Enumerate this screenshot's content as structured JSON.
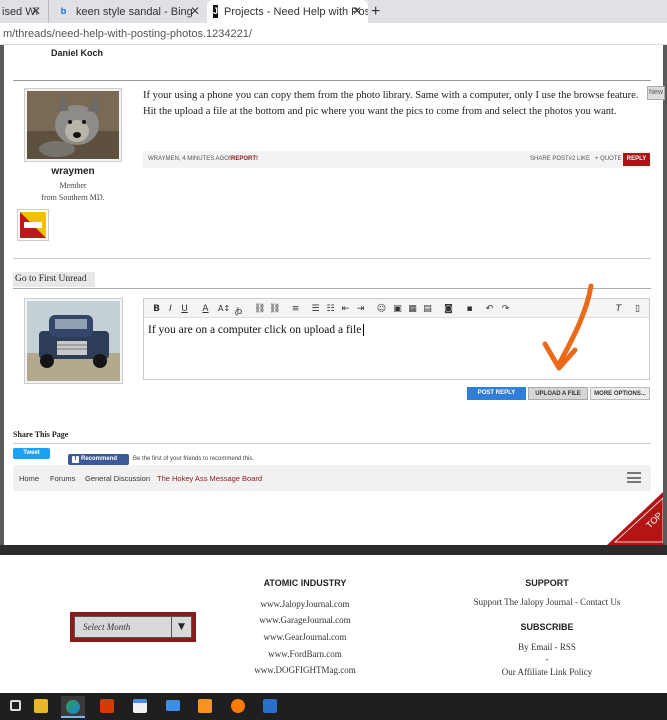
{
  "browser": {
    "tabs": [
      {
        "label": "ised Wi",
        "icon": "page-icon"
      },
      {
        "label": "keen style sandal - Bing",
        "icon": "bing-icon"
      },
      {
        "label": "Projects - Need Help with Postin",
        "icon": "jalopy-icon"
      }
    ],
    "new_tab_label": "+",
    "url": "m/threads/need-help-with-posting-photos.1234221/"
  },
  "prev_post": {
    "author": "Daniel Koch"
  },
  "post": {
    "body": "If your using a phone you can copy them from the photo library. Same with a computer, only I use the browse feature. Hit the upload a file at the bottom and pic where you want the pics to come from and select the photos you want.",
    "username": "wraymen",
    "role": "Member",
    "location": "from Southern MD.",
    "meta": "WRAYMEN, 4 MINUTES AGO",
    "report": "!REPORT!",
    "share": "SHARE POST#2",
    "like": "LIKE",
    "quote": "+ QUOTE",
    "reply": "REPLY",
    "new_badge": "New"
  },
  "go_first_unread": "Go to First Unread",
  "editor": {
    "text": "If you are on a computer click on upload a file",
    "post_reply": "POST REPLY",
    "upload": "UPLOAD A FILE",
    "more": "MORE OPTIONS..."
  },
  "share": {
    "heading": "Share This Page",
    "tweet": "Tweet",
    "recommend": "Recommend",
    "recommend_text": "Be the first of your friends to recommend this."
  },
  "breadcrumb": [
    "Home",
    "Forums",
    "General Discussion",
    "The Hokey Ass Message Board"
  ],
  "top_label": "TOP",
  "footer": {
    "select_month": "Select Month",
    "col1_heading": "ATOMIC INDUSTRY",
    "col1_links": [
      "www.JalopyJournal.com",
      "www.GarageJournal.com",
      "www.GearJournal.com",
      "www.FordBarn.com",
      "www.DOGFIGHTMag.com"
    ],
    "support_heading": "SUPPORT",
    "support_links": "Support The Jalopy Journal - Contact Us",
    "subscribe_heading": "SUBSCRIBE",
    "subscribe_links": "By Email - RSS",
    "dash": "-",
    "affiliate": "Our Affiliate Link Policy"
  },
  "colors": {
    "accent_red": "#8b1a1a",
    "button_blue": "#2f7fd8",
    "facebook": "#3b5998",
    "twitter": "#1da1f2"
  }
}
